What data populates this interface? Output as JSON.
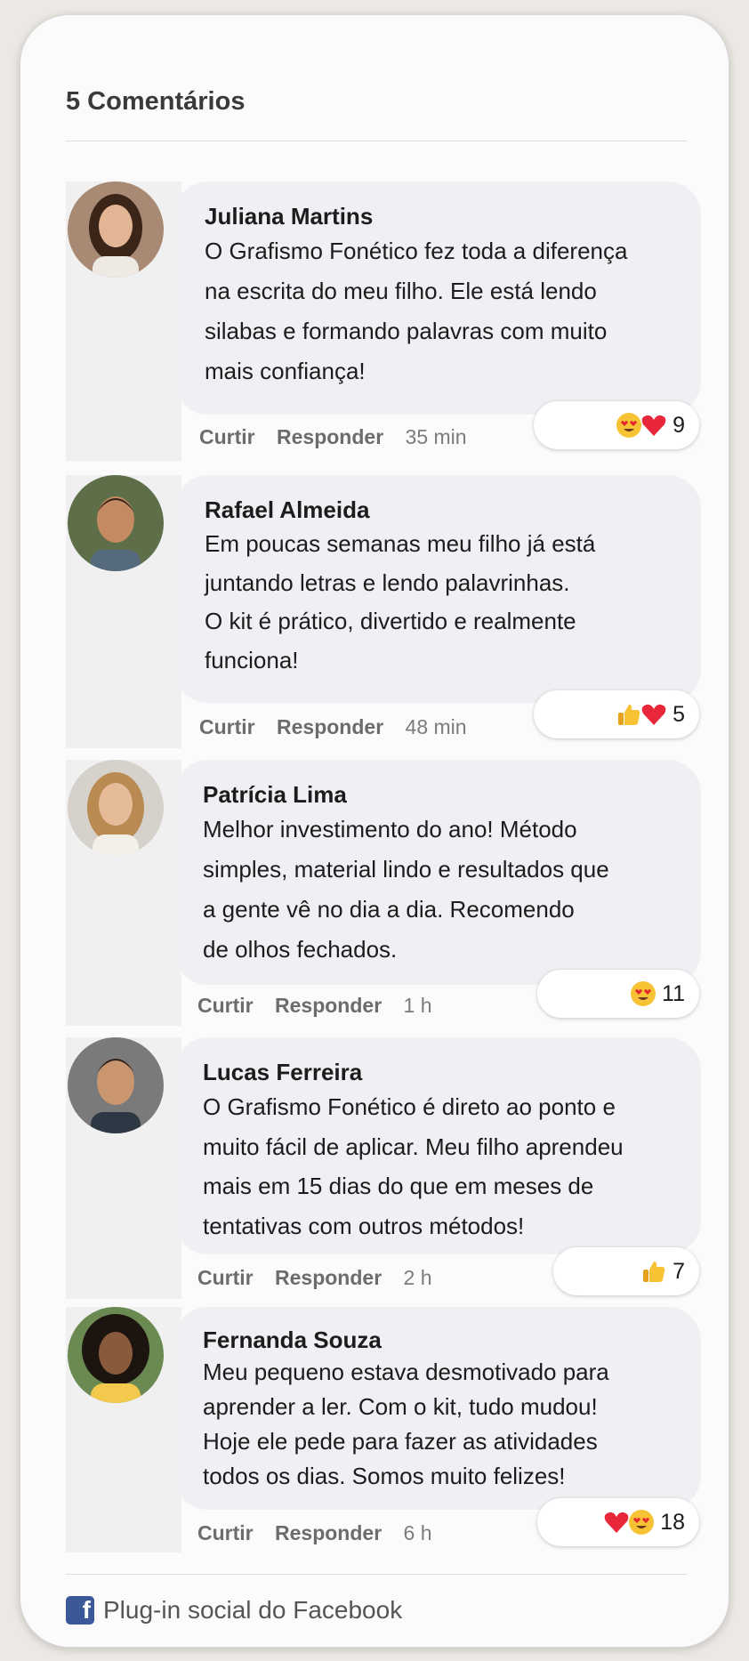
{
  "header": {
    "title": "5 Comentários"
  },
  "actions": {
    "like": "Curtir",
    "reply": "Responder"
  },
  "comments": [
    {
      "name": "Juliana Martins",
      "text": "O Grafismo Fonético fez toda a diferença\nna escrita do meu filho. Ele está lendo\nsilabas e formando palavras com muito\nmais confiança!",
      "time": "35 min",
      "reactions": [
        "heart-eyes-emoji",
        "heart-emoji"
      ],
      "count": "9"
    },
    {
      "name": "Rafael Almeida",
      "text": "Em poucas semanas meu filho já está\njuntando letras e lendo palavrinhas.\nO kit é prático, divertido e realmente\nfunciona!",
      "time": "48 min",
      "reactions": [
        "thumbs-up-emoji",
        "heart-emoji"
      ],
      "count": "5"
    },
    {
      "name": "Patrícia Lima",
      "text": "Melhor investimento do ano! Método\nsimples, material lindo e resultados que\na gente vê no dia a dia. Recomendo\nde olhos fechados.",
      "time": "1 h",
      "reactions": [
        "heart-eyes-emoji"
      ],
      "count": "11"
    },
    {
      "name": "Lucas Ferreira",
      "text": "O Grafismo Fonético é direto ao ponto e\nmuito fácil de aplicar. Meu filho aprendeu\nmais em 15 dias do que em meses de\ntentativas com outros métodos!",
      "time": "2 h",
      "reactions": [
        "thumbs-up-emoji"
      ],
      "count": "7"
    },
    {
      "name": "Fernanda Souza",
      "text": "Meu pequeno estava desmotivado para\naprender a ler. Com o kit, tudo mudou!\nHoje ele pede para fazer as atividades\ntodos os dias. Somos muito felizes!",
      "time": "6 h",
      "reactions": [
        "heart-emoji",
        "heart-eyes-emoji"
      ],
      "count": "18"
    }
  ],
  "footer": {
    "label": "Plug-in social do Facebook",
    "icon": "facebook-icon"
  }
}
